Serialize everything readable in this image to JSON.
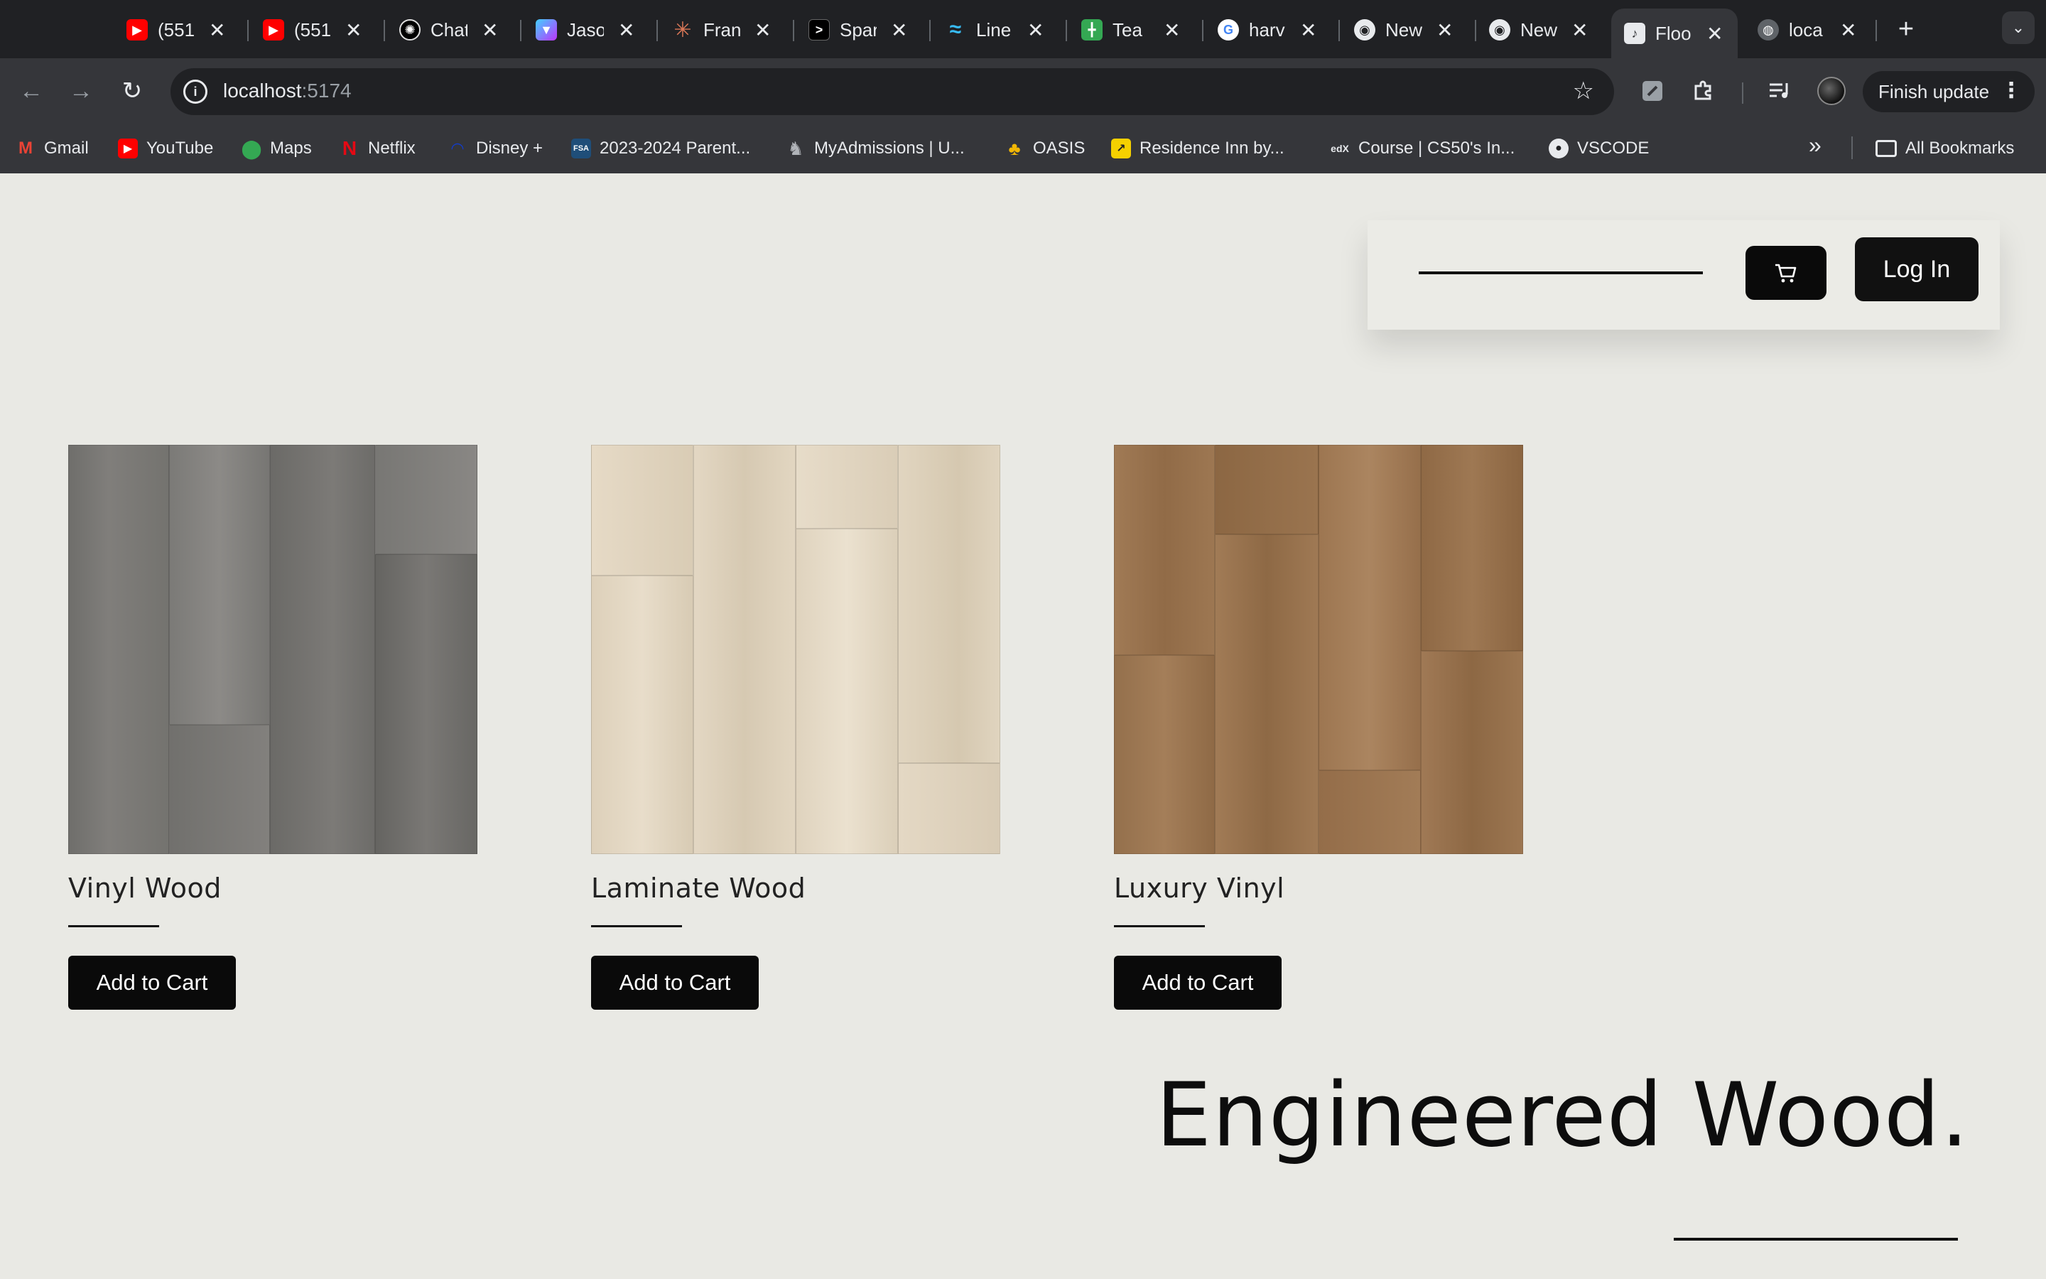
{
  "browser": {
    "tabs": [
      {
        "title": "(551",
        "icon": "youtube-icon",
        "color": "#ff0000"
      },
      {
        "title": "(551",
        "icon": "youtube-icon",
        "color": "#ff0000"
      },
      {
        "title": "Chat",
        "icon": "chatgpt-icon",
        "color": "#000000"
      },
      {
        "title": "Jaso",
        "icon": "vite-icon",
        "color": "#8b5cf6"
      },
      {
        "title": "Fran",
        "icon": "claude-icon",
        "color": "#d97757"
      },
      {
        "title": "Spar",
        "icon": "terminal-icon",
        "color": "#000000"
      },
      {
        "title": "Line",
        "icon": "tailwind-icon",
        "color": "#38bdf8"
      },
      {
        "title": "Tea",
        "icon": "sheets-icon",
        "color": "#34a853"
      },
      {
        "title": "harv",
        "icon": "google-icon",
        "color": "#4285f4"
      },
      {
        "title": "New",
        "icon": "chrome-icon",
        "color": "#9aa0a6"
      },
      {
        "title": "New",
        "icon": "chrome-icon",
        "color": "#9aa0a6"
      },
      {
        "title": "Floo",
        "icon": "page-icon",
        "color": "#8ab4f8",
        "active": true
      },
      {
        "title": "loca",
        "icon": "globe-icon",
        "color": "#9aa0a6"
      }
    ],
    "address": {
      "host": "localhost",
      "port": ":5174"
    },
    "finish_update_label": "Finish update",
    "bookmarks": [
      {
        "label": "Gmail",
        "icon": "gmail-icon",
        "color": "#ea4335"
      },
      {
        "label": "YouTube",
        "icon": "youtube-icon",
        "color": "#ff0000"
      },
      {
        "label": "Maps",
        "icon": "maps-icon",
        "color": "#34a853"
      },
      {
        "label": "Netflix",
        "icon": "netflix-icon",
        "color": "#e50914"
      },
      {
        "label": "Disney +",
        "icon": "disney-icon",
        "color": "#113ccf"
      },
      {
        "label": "2023-2024 Parent...",
        "icon": "fsa-icon",
        "color": "#1f4e79"
      },
      {
        "label": "MyAdmissions | U...",
        "icon": "admissions-icon",
        "color": "#6b7280"
      },
      {
        "label": "OASIS",
        "icon": "palm-icon",
        "color": "#0e7490"
      },
      {
        "label": "Residence Inn by...",
        "icon": "residence-icon",
        "color": "#f5d000"
      },
      {
        "label": "Course | CS50's In...",
        "icon": "edx-icon",
        "color": "#02262b"
      },
      {
        "label": "VSCODE",
        "icon": "github-icon",
        "color": "#ffffff"
      }
    ],
    "all_bookmarks_label": "All Bookmarks"
  },
  "header": {
    "login_label": "Log In"
  },
  "products": [
    {
      "name": "Vinyl Wood",
      "button": "Add to Cart",
      "swatch": "#7c7b79"
    },
    {
      "name": "Laminate Wood",
      "button": "Add to Cart",
      "swatch": "#e4d8c3"
    },
    {
      "name": "Luxury Vinyl",
      "button": "Add to Cart",
      "swatch": "#9c7550"
    }
  ],
  "section": {
    "title": "Engineered Wood."
  }
}
